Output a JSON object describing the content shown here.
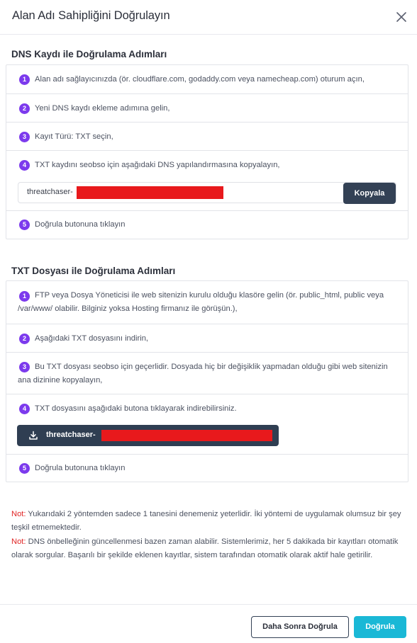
{
  "modal": {
    "title": "Alan Adı Sahipliğini Doğrulayın"
  },
  "dns_section": {
    "title": "DNS Kaydı ile Doğrulama Adımları",
    "steps": [
      {
        "num": "1",
        "text": "Alan adı sağlayıcınızda (ör. cloudflare.com, godaddy.com veya namecheap.com) oturum açın,"
      },
      {
        "num": "2",
        "text": "Yeni DNS kaydı ekleme adımına gelin,"
      },
      {
        "num": "3",
        "text": "Kayıt Türü: TXT seçin,"
      },
      {
        "num": "4",
        "text": "TXT kaydını seobso için aşağıdaki DNS yapılandırmasına kopyalayın,"
      },
      {
        "num": "5",
        "text": "Doğrula butonuna tıklayın"
      }
    ],
    "dns_value_prefix": "threatchaser-",
    "copy_label": "Kopyala"
  },
  "txt_section": {
    "title": "TXT Dosyası ile Doğrulama Adımları",
    "steps": [
      {
        "num": "1",
        "text": "FTP veya Dosya Yöneticisi ile web sitenizin kurulu olduğu klasöre gelin (ör. public_html, public veya /var/www/ olabilir. Bilginiz yoksa Hosting firmanız ile görüşün.),"
      },
      {
        "num": "2",
        "text": "Aşağıdaki TXT dosyasını indirin,"
      },
      {
        "num": "3",
        "text": "Bu TXT dosyası seobso için geçerlidir. Dosyada hiç bir değişiklik yapmadan olduğu gibi web sitenizin ana dizinine kopyalayın,"
      },
      {
        "num": "4",
        "text": "TXT dosyasını aşağıdaki butona tıklayarak indirebilirsiniz."
      },
      {
        "num": "5",
        "text": "Doğrula butonuna tıklayın"
      }
    ],
    "download_label_prefix": "threatchaser-"
  },
  "notes": [
    {
      "label": "Not:",
      "text": " Yukarıdaki 2 yöntemden sadece 1 tanesini denemeniz yeterlidir. İki yöntemi de uygulamak olumsuz bir şey teşkil etmemektedir."
    },
    {
      "label": "Not:",
      "text": " DNS önbelleğinin güncellenmesi bazen zaman alabilir. Sistemlerimiz, her 5 dakikada bir kayıtları otomatik olarak sorgular. Başarılı bir şekilde eklenen kayıtlar, sistem tarafından otomatik olarak aktif hale getirilir."
    }
  ],
  "footer": {
    "later_label": "Daha Sonra Doğrula",
    "verify_label": "Doğrula"
  },
  "colors": {
    "step_badge": "#7c3aed",
    "dark_button": "#334155",
    "primary_button": "#1ab8d6",
    "note_label": "#e02424",
    "redaction": "#e8191c"
  },
  "icons": {
    "close": "close-icon",
    "download": "download-icon"
  }
}
